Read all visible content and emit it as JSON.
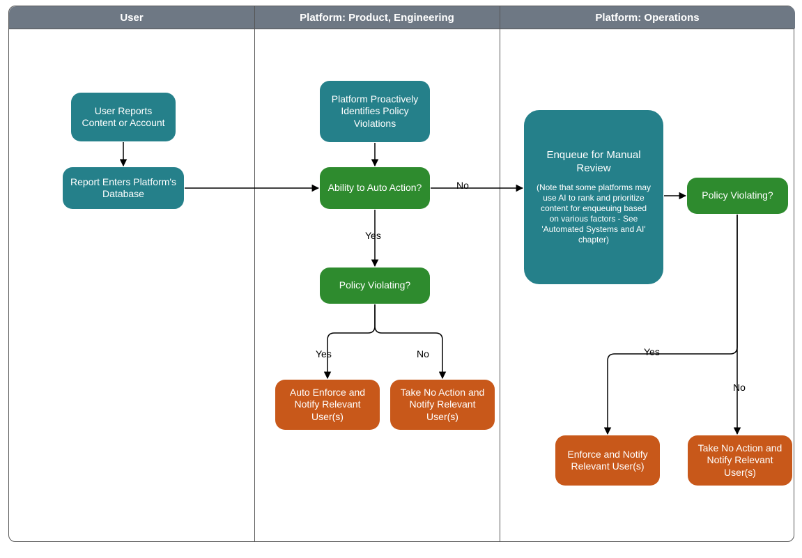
{
  "lanes": {
    "user": "User",
    "eng": "Platform: Product, Engineering",
    "ops": "Platform: Operations"
  },
  "nodes": {
    "user_reports": "User Reports Content or Account",
    "report_enters": "Report Enters Platform's Database",
    "platform_proactive": "Platform Proactively Identifies Policy Violations",
    "auto_action_q": "Ability to Auto Action?",
    "policy_violating_eng": "Policy Violating?",
    "auto_enforce": "Auto Enforce and Notify Relevant User(s)",
    "take_no_action_eng": "Take No Action and Notify Relevant User(s)",
    "enqueue_main": "Enqueue for Manual Review",
    "enqueue_note": "(Note that some platforms may use AI to rank and prioritize content for enqueuing based on various factors - See 'Automated Systems and AI' chapter)",
    "policy_violating_ops": "Policy Violating?",
    "enforce_ops": "Enforce and Notify Relevant User(s)",
    "take_no_action_ops": "Take No Action and Notify Relevant User(s)"
  },
  "labels": {
    "yes": "Yes",
    "no": "No"
  }
}
